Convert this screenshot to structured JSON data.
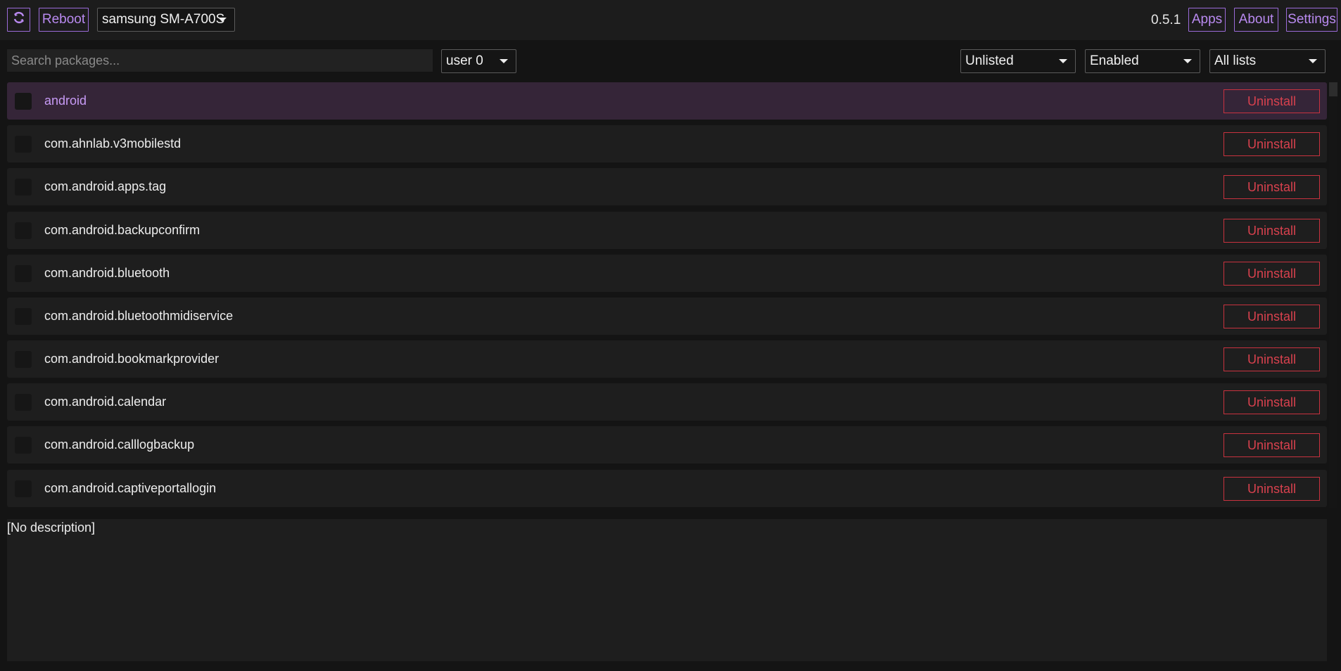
{
  "toolbar": {
    "refresh_icon": "refresh-icon",
    "reboot_label": "Reboot",
    "device": "samsung SM-A700S",
    "version": "0.5.1",
    "apps_label": "Apps",
    "about_label": "About",
    "settings_label": "Settings"
  },
  "filters": {
    "search_placeholder": "Search packages...",
    "user": "user 0",
    "list_state": "Unlisted",
    "enabled_state": "Enabled",
    "lists": "All lists"
  },
  "packages": [
    {
      "name": "android",
      "action": "Uninstall",
      "selected": true
    },
    {
      "name": "com.ahnlab.v3mobilestd",
      "action": "Uninstall"
    },
    {
      "name": "com.android.apps.tag",
      "action": "Uninstall"
    },
    {
      "name": "com.android.backupconfirm",
      "action": "Uninstall"
    },
    {
      "name": "com.android.bluetooth",
      "action": "Uninstall"
    },
    {
      "name": "com.android.bluetoothmidiservice",
      "action": "Uninstall"
    },
    {
      "name": "com.android.bookmarkprovider",
      "action": "Uninstall"
    },
    {
      "name": "com.android.calendar",
      "action": "Uninstall"
    },
    {
      "name": "com.android.calllogbackup",
      "action": "Uninstall"
    },
    {
      "name": "com.android.captiveportallogin",
      "action": "Uninstall"
    }
  ],
  "description": {
    "text": "[No description]"
  },
  "colors": {
    "accent": "#b98af0",
    "danger": "#d8414e",
    "background": "#141414",
    "row": "#1e1e1e",
    "selected_row": "#352538"
  }
}
